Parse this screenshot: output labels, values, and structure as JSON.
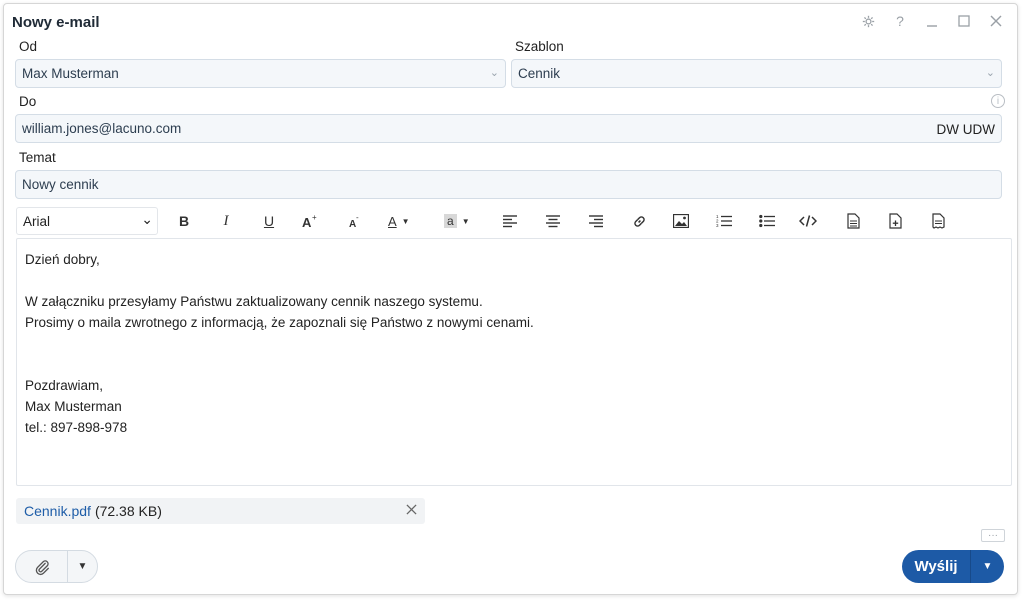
{
  "window": {
    "title": "Nowy e-mail"
  },
  "form": {
    "from_label": "Od",
    "from_value": "Max Musterman",
    "template_label": "Szablon",
    "template_value": "Cennik",
    "to_label": "Do",
    "to_value": "william.jones@lacuno.com",
    "cc_bcc": "DW UDW",
    "subject_label": "Temat",
    "subject_value": "Nowy cennik"
  },
  "toolbar": {
    "font": "Arial",
    "bold": "B",
    "italic": "I",
    "underline": "U",
    "font_color_glyph": "A",
    "bg_color_glyph": "a"
  },
  "body_lines": [
    "Dzień dobry,",
    "",
    "W załączniku przesyłamy Państwu zaktualizowany cennik naszego systemu.",
    "Prosimy o maila zwrotnego z informacją, że zapoznali się Państwo z nowymi cenami.",
    "",
    "",
    "Pozdrawiam,",
    "Max Musterman",
    "tel.: 897-898-978"
  ],
  "attachment": {
    "filename": "Cennik.pdf",
    "size": "(72.38 KB)"
  },
  "actions": {
    "send_label": "Wyślij",
    "more_dots": "···"
  },
  "colors": {
    "accent": "#1d5aa6",
    "link": "#1e5da8",
    "field_bg": "#f4f7fa"
  }
}
